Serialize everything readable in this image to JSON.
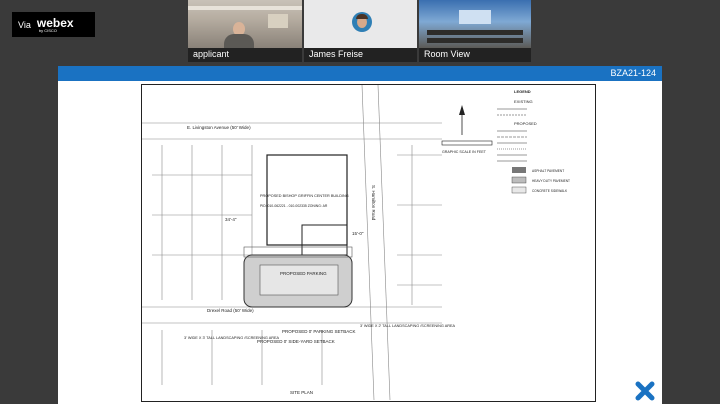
{
  "app": {
    "via": "Via",
    "brand": "webex",
    "by": "by CISCO"
  },
  "participants": [
    {
      "name": "applicant"
    },
    {
      "name": "James Freise"
    },
    {
      "name": "Room View"
    }
  ],
  "share": {
    "case_id": "BZA21-124",
    "plan": {
      "street_top": "E. Livingston Avenue (50' Wide)",
      "street_left": "Drexel Road (50' Wide)",
      "street_right": "S. Hamilton Road",
      "building": "PROPOSED BISHOP GRIFFIN CENTER BUILDING",
      "parcel": "PID: 010-062221 - 010-002335 ZONING: AR",
      "parking": "PROPOSED PARKING",
      "setback_parking": "PROPOSED 0' PARKING SETBACK",
      "setback_side": "PROPOSED 0' SIDE-YARD SETBACK",
      "landscaping_left": "3' WIDE X 3' TALL LANDSCAPING /SCREENING AREA",
      "landscaping_right": "3' WIDE X 2' TALL LANDSCAPING /SCREENING AREA",
      "sheet_title": "SITE PLAN",
      "legend_title": "LEGEND",
      "legend_existing": "EXISTING",
      "legend_proposed": "PROPOSED",
      "legend_items": [
        "RIGHT-OF-WAY LINE",
        "SETBACK LINE",
        "PROPERTY LINE",
        "ASPHALT PAVEMENT",
        "HEAVY DUTY PAVEMENT",
        "CONCRETE SIDEWALK"
      ],
      "scale_label": "GRAPHIC SCALE IN FEET",
      "dim_a": "34'-4\"",
      "dim_b": "15'-0\""
    }
  }
}
